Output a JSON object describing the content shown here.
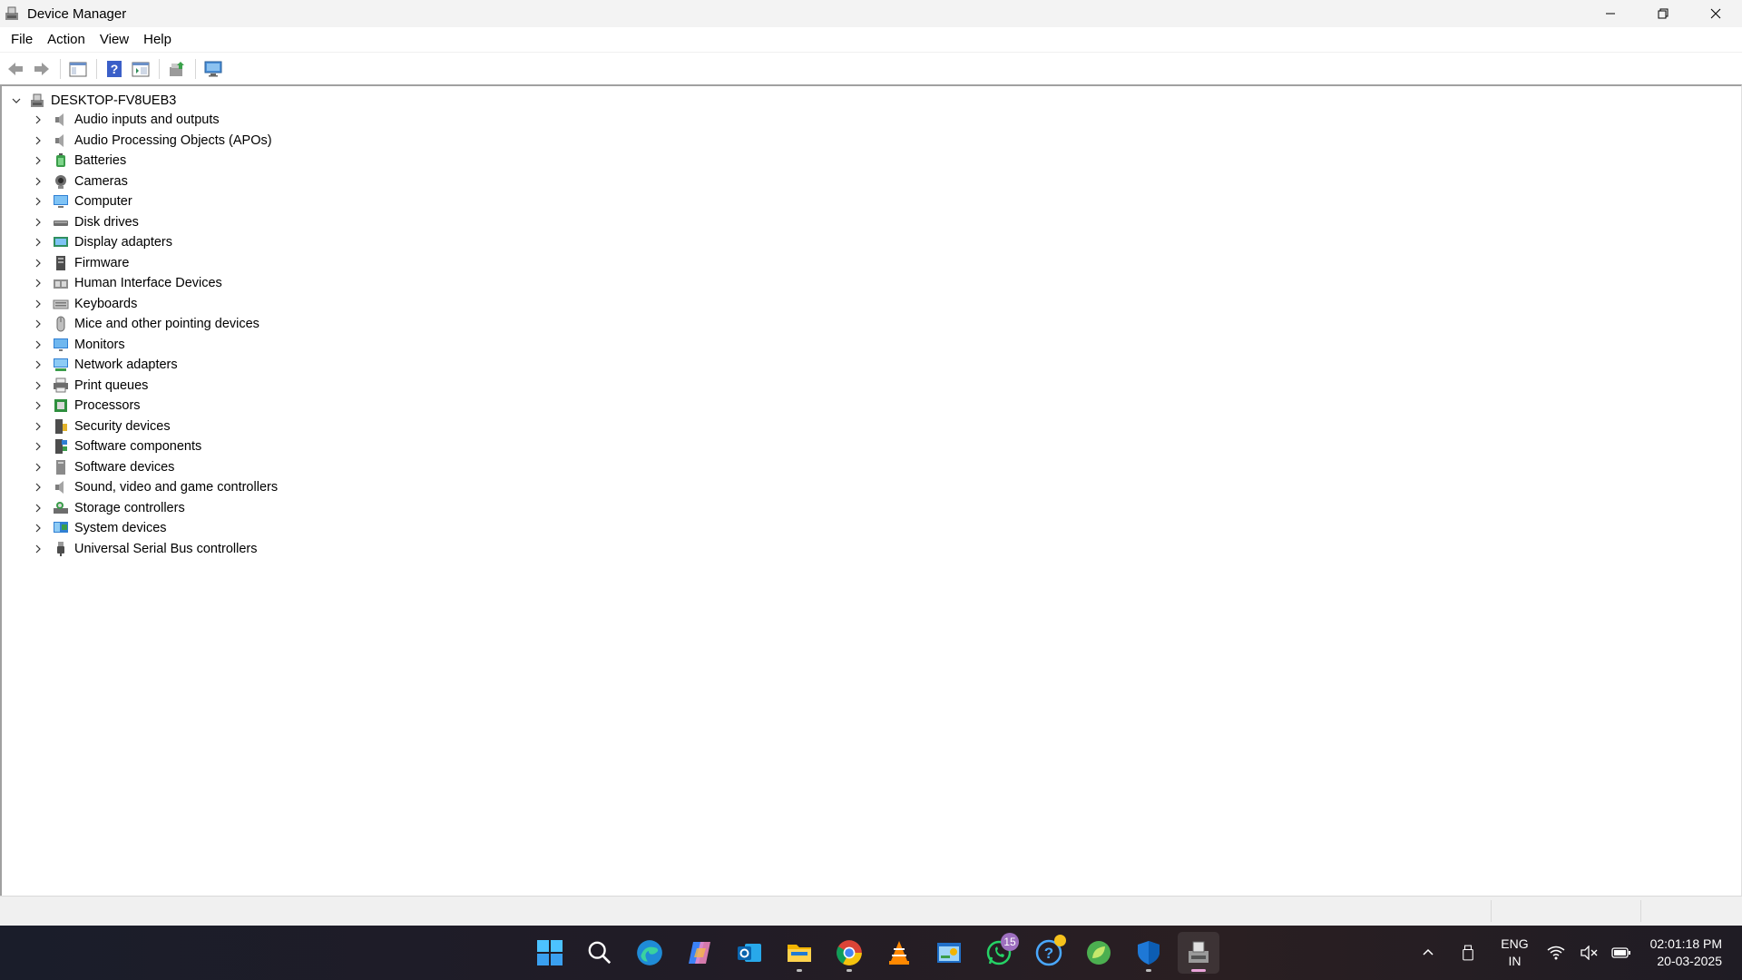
{
  "window": {
    "title": "Device Manager"
  },
  "menu": [
    "File",
    "Action",
    "View",
    "Help"
  ],
  "toolbar": {
    "buttons": [
      "back-icon",
      "forward-icon",
      "show-hide-console-tree-icon",
      "help-icon",
      "properties-icon",
      "update-driver-icon",
      "scan-hardware-icon"
    ]
  },
  "tree": {
    "root": "DESKTOP-FV8UEB3",
    "items": [
      {
        "label": "Audio inputs and outputs",
        "icon": "speaker-icon"
      },
      {
        "label": "Audio Processing Objects (APOs)",
        "icon": "speaker-icon"
      },
      {
        "label": "Batteries",
        "icon": "battery-icon"
      },
      {
        "label": "Cameras",
        "icon": "camera-icon"
      },
      {
        "label": "Computer",
        "icon": "computer-icon"
      },
      {
        "label": "Disk drives",
        "icon": "disk-drive-icon"
      },
      {
        "label": "Display adapters",
        "icon": "display-adapter-icon"
      },
      {
        "label": "Firmware",
        "icon": "firmware-icon"
      },
      {
        "label": "Human Interface Devices",
        "icon": "hid-icon"
      },
      {
        "label": "Keyboards",
        "icon": "keyboard-icon"
      },
      {
        "label": "Mice and other pointing devices",
        "icon": "mouse-icon"
      },
      {
        "label": "Monitors",
        "icon": "monitor-icon"
      },
      {
        "label": "Network adapters",
        "icon": "network-adapter-icon"
      },
      {
        "label": "Print queues",
        "icon": "printer-icon"
      },
      {
        "label": "Processors",
        "icon": "processor-icon"
      },
      {
        "label": "Security devices",
        "icon": "security-device-icon"
      },
      {
        "label": "Software components",
        "icon": "software-component-icon"
      },
      {
        "label": "Software devices",
        "icon": "software-device-icon"
      },
      {
        "label": "Sound, video and game controllers",
        "icon": "speaker-icon"
      },
      {
        "label": "Storage controllers",
        "icon": "storage-controller-icon"
      },
      {
        "label": "System devices",
        "icon": "system-device-icon"
      },
      {
        "label": "Universal Serial Bus controllers",
        "icon": "usb-icon"
      }
    ]
  },
  "taskbar": {
    "apps": [
      {
        "name": "start-icon"
      },
      {
        "name": "search-icon"
      },
      {
        "name": "edge-icon"
      },
      {
        "name": "copilot-icon"
      },
      {
        "name": "outlook-icon"
      },
      {
        "name": "file-explorer-icon",
        "running": true
      },
      {
        "name": "chrome-icon",
        "running": true
      },
      {
        "name": "vlc-icon"
      },
      {
        "name": "control-panel-icon"
      },
      {
        "name": "whatsapp-icon",
        "badge": "15"
      },
      {
        "name": "get-help-icon",
        "dot": true
      },
      {
        "name": "leaf-app-icon"
      },
      {
        "name": "defender-icon",
        "running": true
      },
      {
        "name": "device-manager-icon",
        "active": true
      }
    ],
    "tray": {
      "lang_line1": "ENG",
      "lang_line2": "IN",
      "time": "02:01:18 PM",
      "date": "20-03-2025"
    }
  },
  "colors": {
    "accent_blue": "#0067c0",
    "tree_line": "#a0a0a0",
    "badge_purple": "#9d6fbf",
    "dot_yellow": "#f6c21c"
  }
}
